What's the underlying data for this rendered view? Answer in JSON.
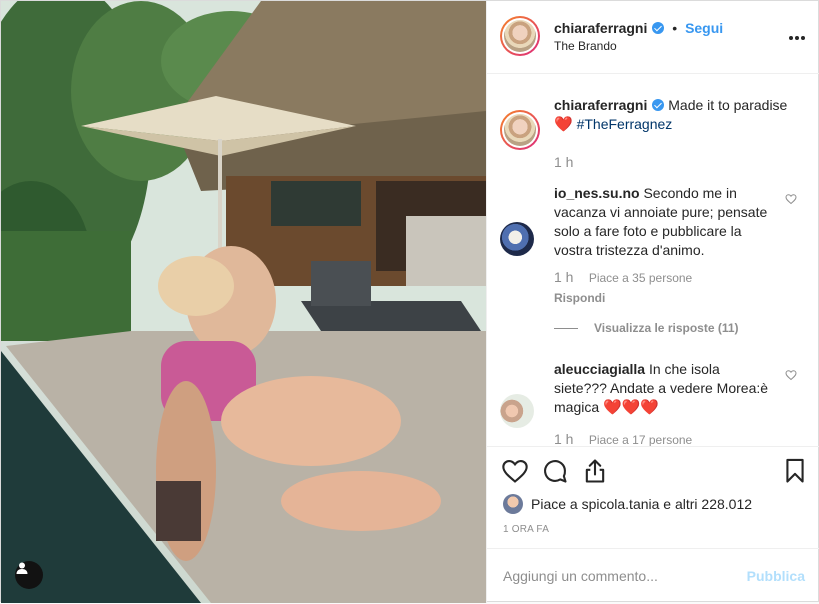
{
  "post": {
    "username": "chiaraferragni",
    "follow_label": "Segui",
    "separator": "•",
    "location": "The Brando",
    "caption": {
      "username": "chiaraferragni",
      "text": "Made it to paradise",
      "emoji": "❤️",
      "hashtag": "#TheFerragnez",
      "time": "1 h"
    },
    "comments": [
      {
        "username": "io_nes.su.no",
        "text": "Secondo me in vacanza vi annoiate pure; pensate solo a fare foto e pubblicare la vostra tristezza d'animo.",
        "time": "1 h",
        "likes": "Piace a 35 persone",
        "reply_label": "Rispondi"
      },
      {
        "username": "aleucciagialla",
        "text": "In che isola siete??? Andate a vedere Morea:è magica",
        "emojis": "❤️❤️❤️",
        "time": "1 h",
        "likes": "Piace a 17 persone"
      }
    ],
    "view_replies_label": "Visualizza le risposte (11)",
    "liked_by": "Piace a spicola.tania e altri 228.012",
    "timestamp": "1 ORA FA",
    "comment_placeholder": "Aggiungi un commento...",
    "publish_label": "Pubblica",
    "icons": [
      "heart-icon",
      "comment-icon",
      "share-icon",
      "bookmark-icon",
      "more-options-icon",
      "verified-badge-icon",
      "user-tag-icon"
    ],
    "colors": {
      "link_blue": "#3897f0",
      "muted": "#8e8e8e",
      "text": "#262626",
      "publish_disabled": "#b2dffc",
      "heart_red": "#ed4956"
    }
  }
}
